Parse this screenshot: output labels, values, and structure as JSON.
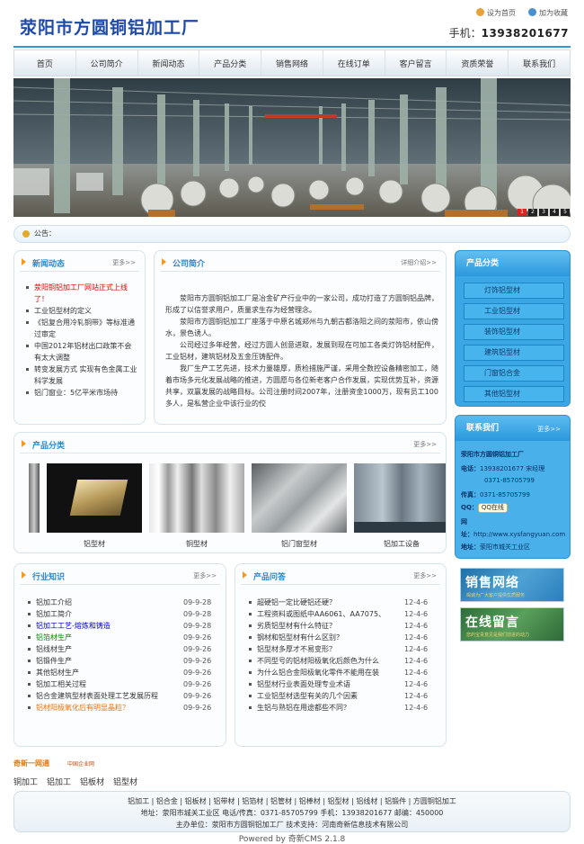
{
  "header": {
    "logo": "荥阳市方圆铜铝加工厂",
    "set_home": "设为首页",
    "add_fav": "加为收藏",
    "phone_label": "手机：",
    "phone": "13938201677"
  },
  "nav": [
    "首页",
    "公司简介",
    "新闻动态",
    "产品分类",
    "销售网络",
    "在线订单",
    "客户留言",
    "资质荣誉",
    "联系我们"
  ],
  "banner": {
    "pages": [
      "1",
      "2",
      "3",
      "4",
      "5"
    ],
    "active": 0
  },
  "notice": {
    "label": "公告："
  },
  "news": {
    "title": "新闻动态",
    "more": "更多>>",
    "items": [
      {
        "text": "荥阳铜铝加工厂网站正式上线了！",
        "style": "red"
      },
      {
        "text": "工业铝型材的定义",
        "style": ""
      },
      {
        "text": "《铝复合用冷轧铜带》等标准通过审定",
        "style": ""
      },
      {
        "text": "中国2012年铝材出口政策不会有太大调整",
        "style": ""
      },
      {
        "text": "转变发展方式 实现有色金属工业科学发展",
        "style": ""
      },
      {
        "text": "铝门窗业：5亿平米市场待",
        "style": ""
      }
    ]
  },
  "about": {
    "title": "公司简介",
    "more": "详细介绍>>",
    "paragraphs": [
      "荥阳市方圆铜铝加工厂是冶金矿产行业中的一家公司，成功打造了方圆铜铝品牌，形成了以信誉求用户，质量求生存为经营理念。",
      "荥阳市方圆铜铝加工厂座落于中原名城郑州与九朝古都洛阳之间的荥阳市，依山傍水，景色诱人。",
      "公司经过多年经营，经过方圆人创意进取，发展到现在可加工各类灯饰铝材配件，工业铝材，建筑铝材及五金压铸配件。",
      "我厂生产工艺先进，技术力量雄厚，质检措施严谨，采用全数控设备精密加工，随着市场多元化发展战略的推进，方圆愿与各位新老客户合作发展，实现优势互补，资源共享，双赢发展的战略目标。公司注册时间2007年，注册资金1000万，现有员工100多人，是私营企业中该行业的佼"
    ]
  },
  "products": {
    "title": "产品分类",
    "more": "更多>>",
    "items": [
      "铝型材",
      "铜型材",
      "铝门窗型材",
      "铝加工设备"
    ]
  },
  "industry": {
    "title": "行业知识",
    "more": "更多>>",
    "items": [
      {
        "text": "铝加工介绍",
        "date": "09-9-28",
        "style": ""
      },
      {
        "text": "铝加工简介",
        "date": "09-9-28",
        "style": ""
      },
      {
        "text": "铝加工工艺-熔炼和铸造",
        "date": "09-9-28",
        "style": "blue"
      },
      {
        "text": "铝箔材生产",
        "date": "09-9-26",
        "style": "green"
      },
      {
        "text": "铝线材生产",
        "date": "09-9-26",
        "style": ""
      },
      {
        "text": "铝锻件生产",
        "date": "09-9-26",
        "style": ""
      },
      {
        "text": "其他铝材生产",
        "date": "09-9-26",
        "style": ""
      },
      {
        "text": "铝加工相关过程",
        "date": "09-9-26",
        "style": ""
      },
      {
        "text": "铝合金建筑型材表面处理工艺发展历程",
        "date": "09-9-26",
        "style": ""
      },
      {
        "text": "铝材阳极氧化后有明显晶粒？",
        "date": "09-9-26",
        "style": "orange"
      }
    ]
  },
  "faq": {
    "title": "产品问答",
    "more": "更多>>",
    "items": [
      {
        "text": "超硬铝一定比硬铝还硬？",
        "date": "12-4-6"
      },
      {
        "text": "工程资料或图纸中AA6061、AA7075、",
        "date": "12-4-6"
      },
      {
        "text": "劣质铝型材有什么特征？",
        "date": "12-4-6"
      },
      {
        "text": "钢材和铝型材有什么区别？",
        "date": "12-4-6"
      },
      {
        "text": "铝型材多厚才不易变形？",
        "date": "12-4-6"
      },
      {
        "text": "不同型号的铝材阳极氧化后颜色为什么",
        "date": "12-4-6"
      },
      {
        "text": "为什么铝合金阳极氧化零件不能用在装",
        "date": "12-4-6"
      },
      {
        "text": "铝型材行业表面处理专业术语",
        "date": "12-4-6"
      },
      {
        "text": "工业铝型材选型有关的几个因素",
        "date": "12-4-6"
      },
      {
        "text": "生铝与熟铝在用途都些不同？",
        "date": "12-4-6"
      }
    ]
  },
  "sidebar": {
    "cat_title": "产品分类",
    "categories": [
      "灯饰铝型材",
      "工业铝型材",
      "装饰铝型材",
      "建筑铝型材",
      "门窗铝合金",
      "其他铝型材"
    ],
    "contact_title": "联系我们",
    "contact_more": "更多>>",
    "company": "荥阳市方圆铜铝加工厂",
    "phone_label": "电话：",
    "phone": "13938201677 宋经理",
    "phone2": "0371-85705799",
    "fax_label": "传真：",
    "fax": "0371-85705799",
    "qq_label": "QQ：",
    "qq_btn": "QQ在线",
    "web_label": "网址：",
    "web_prefix": "网",
    "web_prefix2": "址：",
    "web": "http://www.xysfangyuan.com",
    "addr_label": "地址：",
    "addr": "荥阳市城关工业区",
    "ad1": "销售网络",
    "ad1_sub": "竭诚为广大客户提供优质服务",
    "ad2": "在线留言",
    "ad2_sub": "您的宝贵意见是我们前进的动力"
  },
  "footer": {
    "logo1": "奇新一网通",
    "logo2": "中国企业网",
    "links_row": [
      "铜加工",
      "铝加工",
      "铝板材",
      "铝型材"
    ],
    "line1": "铝加工 | 铝合金 | 铝板材 | 铝带材 | 铝箔材 | 铝管材 | 铝棒材 | 铝型材 | 铝线材 | 铝锻件 | 方圆铜铝加工",
    "line2": "地址：荥阳市城关工业区 电话/传真：0371-85705799 手机：13938201677 邮编：450000",
    "line3": "主办单位：荥阳市方圆铜铝加工厂  技术支持：河南奇新信息技术有限公司",
    "powered": "Powered by 奇新CMS 2.1.8"
  },
  "colors": {
    "accent": "#2a8acb",
    "nav_line": "#2b9bd8",
    "red": "#d00",
    "side_blue": "#3aa6e4"
  }
}
